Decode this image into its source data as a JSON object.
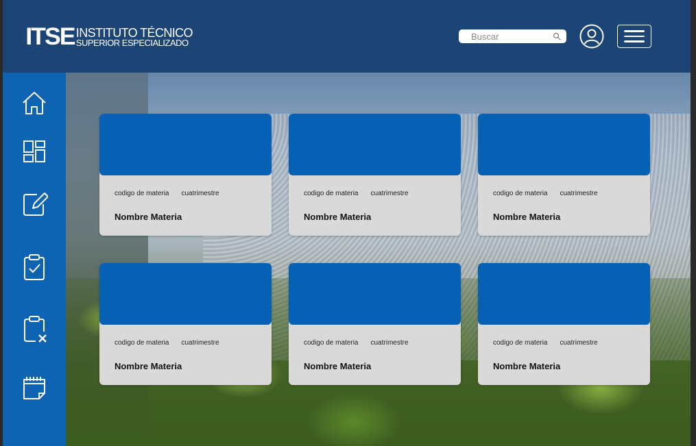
{
  "brand": {
    "mark": "ITSE",
    "line1": "INSTITUTO TÉCNICO",
    "line2": "SUPERIOR ESPECIALIZADO"
  },
  "search": {
    "placeholder": "Buscar",
    "icon": "search-icon"
  },
  "header": {
    "user_icon": "user-circle-icon",
    "menu_icon": "hamburger-menu-icon"
  },
  "sidebar": {
    "items": [
      {
        "icon": "home-icon"
      },
      {
        "icon": "dashboard-icon"
      },
      {
        "icon": "edit-icon"
      },
      {
        "icon": "clipboard-check-icon"
      },
      {
        "icon": "clipboard-x-icon"
      },
      {
        "icon": "calendar-icon"
      }
    ]
  },
  "colors": {
    "header": "#1c4474",
    "sidebar": "#0e63b2",
    "card_header": "#0661b4",
    "card_body": "#d9d9d9"
  },
  "cards": [
    {
      "code": "codigo de materia",
      "term": "cuatrimestre",
      "name": "Nombre Materia"
    },
    {
      "code": "codigo de materia",
      "term": "cuatrimestre",
      "name": "Nombre Materia"
    },
    {
      "code": "codigo de materia",
      "term": "cuatrimestre",
      "name": "Nombre Materia"
    },
    {
      "code": "codigo de materia",
      "term": "cuatrimestre",
      "name": "Nombre Materia"
    },
    {
      "code": "codigo de materia",
      "term": "cuatrimestre",
      "name": "Nombre Materia"
    },
    {
      "code": "codigo de materia",
      "term": "cuatrimestre",
      "name": "Nombre Materia"
    }
  ]
}
